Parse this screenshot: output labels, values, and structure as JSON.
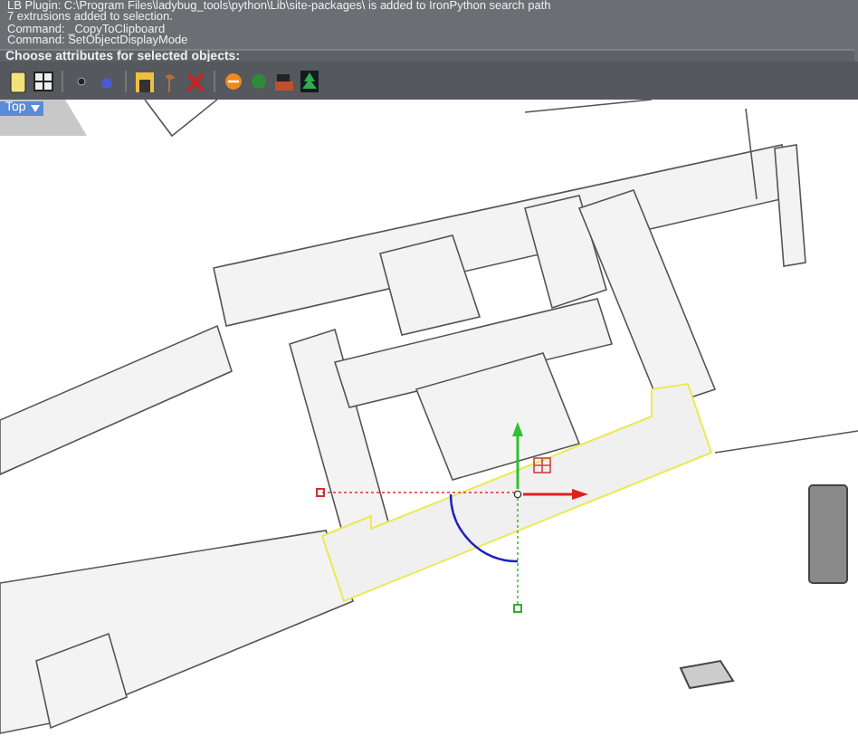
{
  "command_history": {
    "lines": [
      "LB Plugin: C:\\Program Files\\ladybug_tools\\python\\Lib\\site-packages\\ is added to IronPython search path",
      "7 extrusions added to selection.",
      "Command: _CopyToClipboard",
      "Command: SetObjectDisplayMode"
    ],
    "prompt": "Choose attributes for selected objects:"
  },
  "viewport": {
    "label": "Top"
  }
}
